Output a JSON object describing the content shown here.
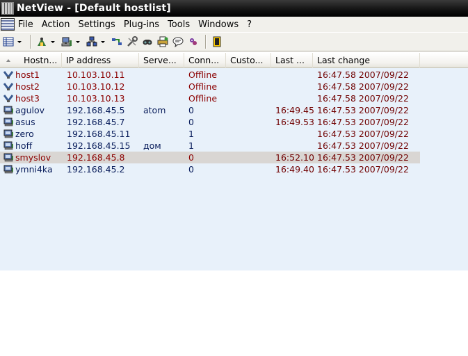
{
  "window": {
    "title": "NetView - [Default hostlist]"
  },
  "menu": [
    "File",
    "Action",
    "Settings",
    "Plug-ins",
    "Tools",
    "Windows",
    "?"
  ],
  "toolbar": {
    "buttons": [
      "view-icon",
      "scan-icon",
      "network-icon",
      "hosts-icon",
      "connect-icon",
      "tools-icon",
      "find-icon",
      "print-icon",
      "chat-icon",
      "plugin-icon",
      "exit-icon"
    ]
  },
  "columns": [
    "Hostn...",
    "IP address",
    "Serve...",
    "Conn...",
    "Custo...",
    "Last ...",
    "Last change"
  ],
  "hosts": [
    {
      "name": "host1",
      "ip": "10.103.10.11",
      "server": "",
      "conn": "Offline",
      "custom": "",
      "last": "",
      "last_change": "16:47.58 2007/09/22",
      "status": "offline"
    },
    {
      "name": "host2",
      "ip": "10.103.10.12",
      "server": "",
      "conn": "Offline",
      "custom": "",
      "last": "",
      "last_change": "16:47.58 2007/09/22",
      "status": "offline"
    },
    {
      "name": "host3",
      "ip": "10.103.10.13",
      "server": "",
      "conn": "Offline",
      "custom": "",
      "last": "",
      "last_change": "16:47.58 2007/09/22",
      "status": "offline"
    },
    {
      "name": "agulov",
      "ip": "192.168.45.5",
      "server": "atom",
      "conn": "0",
      "custom": "",
      "last": "16:49.45",
      "last_change": "16:47.53 2007/09/22",
      "status": "online"
    },
    {
      "name": "asus",
      "ip": "192.168.45.7",
      "server": "",
      "conn": "0",
      "custom": "",
      "last": "16:49.53",
      "last_change": "16:47.53 2007/09/22",
      "status": "online"
    },
    {
      "name": "zero",
      "ip": "192.168.45.11",
      "server": "",
      "conn": "1",
      "custom": "",
      "last": "",
      "last_change": "16:47.53 2007/09/22",
      "status": "online"
    },
    {
      "name": "hoff",
      "ip": "192.168.45.15",
      "server": "дом",
      "conn": "1",
      "custom": "",
      "last": "",
      "last_change": "16:47.53 2007/09/22",
      "status": "online"
    },
    {
      "name": "smyslov",
      "ip": "192.168.45.8",
      "server": "",
      "conn": "0",
      "custom": "",
      "last": "16:52.10",
      "last_change": "16:47.53 2007/09/22",
      "status": "selected"
    },
    {
      "name": "ymni4ka",
      "ip": "192.168.45.2",
      "server": "",
      "conn": "0",
      "custom": "",
      "last": "16:49.40",
      "last_change": "16:47.53 2007/09/22",
      "status": "online"
    }
  ],
  "colors": {
    "offline_text": "#8b0000",
    "online_text": "#0a1e5c",
    "last_change_text": "#700000",
    "list_background": "#e8f1fa",
    "selected_row": "#d9d6d3"
  }
}
